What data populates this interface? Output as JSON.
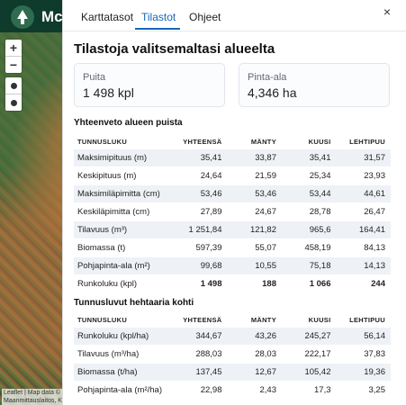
{
  "app": {
    "title_partial": "Mc"
  },
  "map": {
    "zoom_in": "+",
    "zoom_out": "−",
    "attribution_line1": "Leaflet | Map data ©",
    "attribution_line2": "Maanmittauslaitos, K"
  },
  "tabs": [
    "Karttatasot",
    "Tilastot",
    "Ohjeet"
  ],
  "active_tab": "Tilastot",
  "close_label": "×",
  "panel_title": "Tilastoja valitsemaltasi alueelta",
  "cards": [
    {
      "label": "Puita",
      "value": "1 498 kpl"
    },
    {
      "label": "Pinta-ala",
      "value": "4,346 ha"
    }
  ],
  "summary": {
    "title": "Yhteenveto alueen puista",
    "headers": [
      "TUNNUSLUKU",
      "YHTEENSÄ",
      "MÄNTY",
      "KUUSI",
      "LEHTIPUU"
    ],
    "rows": [
      [
        "Maksimipituus (m)",
        "35,41",
        "33,87",
        "35,41",
        "31,57"
      ],
      [
        "Keskipituus (m)",
        "24,64",
        "21,59",
        "25,34",
        "23,93"
      ],
      [
        "Maksimiläpimitta (cm)",
        "53,46",
        "53,46",
        "53,44",
        "44,61"
      ],
      [
        "Keskiläpimitta (cm)",
        "27,89",
        "24,67",
        "28,78",
        "26,47"
      ],
      [
        "Tilavuus (m³)",
        "1 251,84",
        "121,82",
        "965,6",
        "164,41"
      ],
      [
        "Biomassa (t)",
        "597,39",
        "55,07",
        "458,19",
        "84,13"
      ],
      [
        "Pohjapinta-ala (m²)",
        "99,68",
        "10,55",
        "75,18",
        "14,13"
      ],
      [
        "Runkoluku (kpl)",
        "1 498",
        "188",
        "1 066",
        "244"
      ]
    ]
  },
  "per_hectare": {
    "title": "Tunnusluvut hehtaaria kohti",
    "headers": [
      "TUNNUSLUKU",
      "YHTEENSÄ",
      "MÄNTY",
      "KUUSI",
      "LEHTIPUU"
    ],
    "rows": [
      [
        "Runkoluku (kpl/ha)",
        "344,67",
        "43,26",
        "245,27",
        "56,14"
      ],
      [
        "Tilavuus (m³/ha)",
        "288,03",
        "28,03",
        "222,17",
        "37,83"
      ],
      [
        "Biomassa (t/ha)",
        "137,45",
        "12,67",
        "105,42",
        "19,36"
      ],
      [
        "Pohjapinta-ala (m²/ha)",
        "22,98",
        "2,43",
        "17,3",
        "3,25"
      ]
    ]
  },
  "colors": {
    "accent": "#1565c0",
    "header_bg": "#0e3b2b",
    "row_shade": "#eef2f7"
  }
}
